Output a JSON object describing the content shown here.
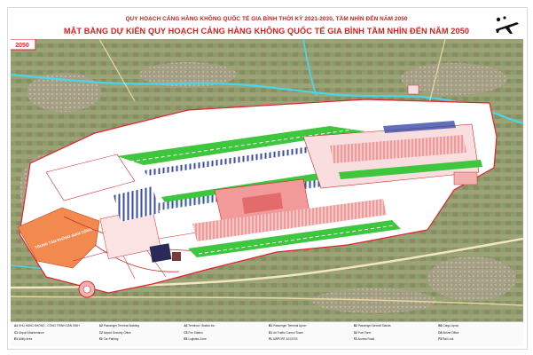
{
  "header": {
    "title_top": "QUY HOẠCH CẢNG HÀNG KHÔNG QUỐC TẾ GIA BÌNH THỜI KỲ 2021-2030, TẦM NHÌN ĐẾN NĂM 2050",
    "title_main": "MẶT BẰNG DỰ KIẾN QUY HOẠCH CẢNG HÀNG KHÔNG QUỐC TẾ GIA BÌNH TẦM NHÌN ĐẾN NĂM 2050"
  },
  "map_labels": {
    "corner_badge": "2050",
    "orange_zone": "TRUNG TÂM KHÔNG GIAN CÔNG"
  },
  "colors": {
    "satellite_fields": "#8e9a6a",
    "runway_green": "#3ec63e",
    "boundary_red": "#e0232e",
    "terminal_pink": "#f29a9a",
    "orange_zone": "#f28a50",
    "apron_pink": "#f3b8b8",
    "river_cyan": "#4ad6e8"
  },
  "legend": [
    {
      "code": "A1",
      "text": "KHU HÀNG KHÔNG - CÔNG TRÌNH DÂN SINH"
    },
    {
      "code": "A2",
      "text": "Passenger Terminal Building"
    },
    {
      "code": "A3",
      "text": "Terminal / Station inc"
    },
    {
      "code": "B1",
      "text": "Passenger Terminal Apron"
    },
    {
      "code": "B2",
      "text": "Passenger Aircraft Stands"
    },
    {
      "code": "B3",
      "text": "Cargo Apron"
    },
    {
      "code": "C1",
      "text": "Airport Maintenance"
    },
    {
      "code": "C2",
      "text": "Airport Security Office"
    },
    {
      "code": "C3",
      "text": "Fire Station"
    },
    {
      "code": "D1",
      "text": "Air Traffic Control Tower"
    },
    {
      "code": "D2",
      "text": "Fuel Farm"
    },
    {
      "code": "D3",
      "text": "Airline Office"
    },
    {
      "code": "E1",
      "text": "Utility Area"
    },
    {
      "code": "E2",
      "text": "Car Parking"
    },
    {
      "code": "E3",
      "text": "Logistics Zone"
    },
    {
      "code": "F1",
      "text": "AIRPORT ACCESS"
    },
    {
      "code": "F2",
      "text": "Access Road"
    },
    {
      "code": "F3",
      "text": "Rail Link"
    }
  ]
}
